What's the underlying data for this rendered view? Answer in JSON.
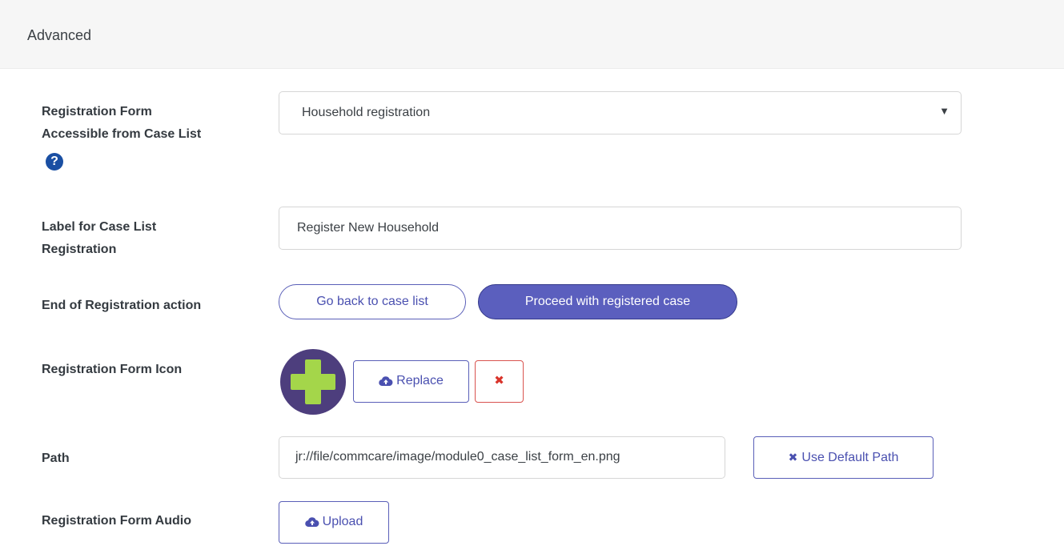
{
  "panel": {
    "title": "Advanced"
  },
  "registration_form": {
    "label_line1": "Registration Form",
    "label_line2": "Accessible from Case List",
    "help_icon": "question-circle-icon",
    "selected": "Household registration",
    "caret": "▼"
  },
  "case_list_label": {
    "label_line1": "Label for Case List",
    "label_line2": "Registration",
    "value": "Register New Household"
  },
  "end_action": {
    "label": "End of Registration action",
    "option_back": "Go back to case list",
    "option_proceed": "Proceed with registered case",
    "selected": "Proceed with registered case"
  },
  "form_icon": {
    "label": "Registration Form Icon",
    "thumbnail_icon": "plus-icon",
    "replace_label": "Replace",
    "remove_glyph": "✖"
  },
  "path": {
    "label": "Path",
    "value": "jr://file/commcare/image/module0_case_list_form_en.png",
    "default_label": "Use Default Path",
    "default_glyph": "✖"
  },
  "form_audio": {
    "label": "Registration Form Audio",
    "upload_label": "Upload"
  },
  "colors": {
    "primary": "#5b5fbe",
    "primary_border": "#34398a",
    "danger": "#d9342b",
    "help": "#1a4fa3",
    "icon_bg": "#4d3e7d",
    "icon_plus": "#a4d64a"
  }
}
